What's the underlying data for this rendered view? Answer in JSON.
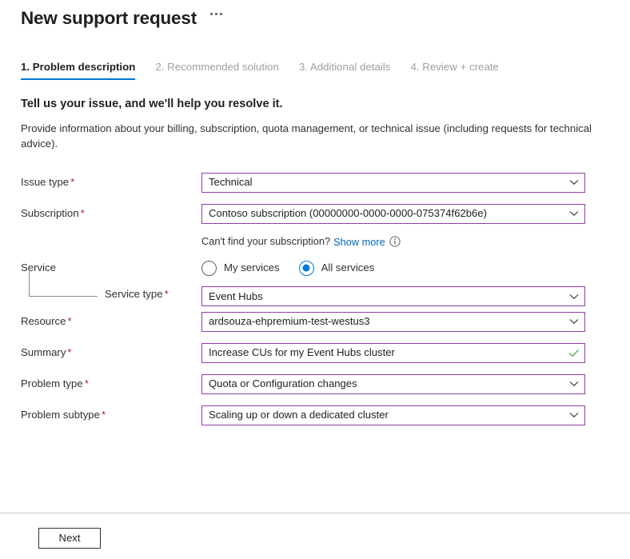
{
  "header": {
    "title": "New support request",
    "more_menu": "…"
  },
  "tabs": [
    {
      "label": "1. Problem description",
      "active": true
    },
    {
      "label": "2. Recommended solution",
      "active": false
    },
    {
      "label": "3. Additional details",
      "active": false
    },
    {
      "label": "4. Review + create",
      "active": false
    }
  ],
  "intro": {
    "heading": "Tell us your issue, and we'll help you resolve it.",
    "body": "Provide information about your billing, subscription, quota management, or technical issue (including requests for technical advice)."
  },
  "fields": {
    "issue_type": {
      "label": "Issue type",
      "required": "*",
      "value": "Technical"
    },
    "subscription": {
      "label": "Subscription",
      "required": "*",
      "value": "Contoso subscription (00000000-0000-0000-075374f62b6e)"
    },
    "service": {
      "label": "Service"
    },
    "service_type": {
      "label": "Service type",
      "required": "*",
      "value": "Event Hubs"
    },
    "resource": {
      "label": "Resource",
      "required": "*",
      "value": "ardsouza-ehpremium-test-westus3"
    },
    "summary": {
      "label": "Summary",
      "required": "*",
      "value": "Increase CUs for my Event Hubs cluster"
    },
    "problem_type": {
      "label": "Problem type",
      "required": "*",
      "value": "Quota or Configuration changes"
    },
    "problem_subtype": {
      "label": "Problem subtype",
      "required": "*",
      "value": "Scaling up or down a dedicated cluster"
    }
  },
  "subscription_hint": {
    "text": "Can't find your subscription?",
    "link": "Show more"
  },
  "service_scope": {
    "options": [
      {
        "label": "My services",
        "selected": false
      },
      {
        "label": "All services",
        "selected": true
      }
    ]
  },
  "footer": {
    "next_label": "Next"
  },
  "colors": {
    "accent_blue": "#0078d4",
    "link_blue": "#0067b8",
    "field_border_purple": "#8f3fa8",
    "required_red": "#a4262c",
    "valid_green": "#5db85c"
  }
}
